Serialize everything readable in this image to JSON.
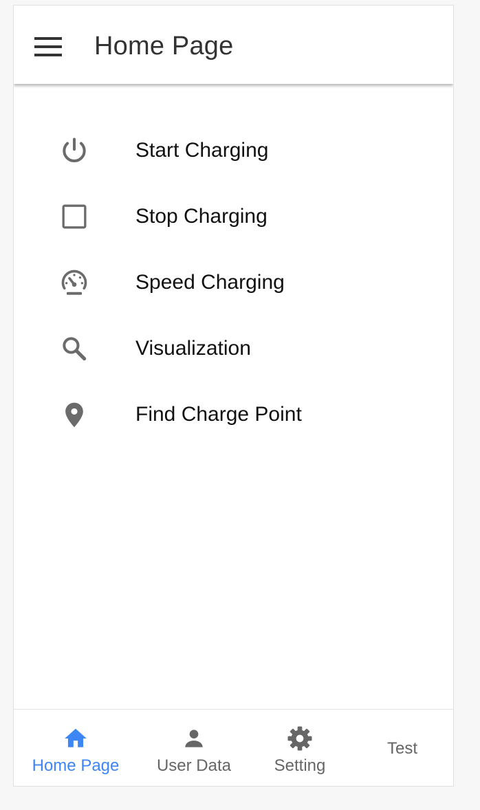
{
  "app_bar": {
    "title": "Home Page",
    "menu_icon": "hamburger-menu-icon"
  },
  "menu": {
    "items": [
      {
        "label": "Start Charging",
        "icon": "power-icon"
      },
      {
        "label": "Stop Charging",
        "icon": "square-stop-icon"
      },
      {
        "label": "Speed Charging",
        "icon": "speedometer-icon"
      },
      {
        "label": "Visualization",
        "icon": "magnifier-icon"
      },
      {
        "label": "Find Charge Point",
        "icon": "map-pin-icon"
      }
    ]
  },
  "bottom_nav": {
    "items": [
      {
        "label": "Home Page",
        "icon": "home-icon",
        "active": true
      },
      {
        "label": "User Data",
        "icon": "person-icon",
        "active": false
      },
      {
        "label": "Setting",
        "icon": "gear-icon",
        "active": false
      },
      {
        "label": "Test",
        "icon": "",
        "active": false
      }
    ]
  },
  "colors": {
    "accent": "#3d86f5",
    "icon": "#6b6b6b",
    "text": "#111111",
    "title": "#333333"
  }
}
